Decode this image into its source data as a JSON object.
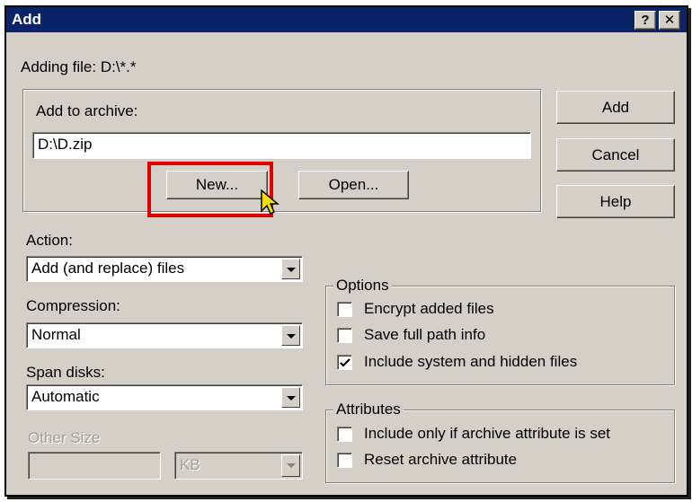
{
  "window": {
    "title": "Add",
    "help_button": "?",
    "close_button": "✕"
  },
  "adding_file_label": "Adding file: D:\\*.*",
  "archive_group": {
    "label": "Add to archive:",
    "path_value": "D:\\D.zip",
    "new_button": "New...",
    "open_button": "Open..."
  },
  "side_buttons": {
    "add": "Add",
    "cancel": "Cancel",
    "help": "Help"
  },
  "action": {
    "label": "Action:",
    "value": "Add (and replace) files"
  },
  "compression": {
    "label": "Compression:",
    "value": "Normal"
  },
  "span_disks": {
    "label": "Span disks:",
    "value": "Automatic"
  },
  "other_size": {
    "label": "Other Size",
    "value": "",
    "unit": "KB"
  },
  "options": {
    "title": "Options",
    "items": [
      {
        "label": "Encrypt added files",
        "checked": false
      },
      {
        "label": "Save full path info",
        "checked": false
      },
      {
        "label": "Include system and hidden files",
        "checked": true
      }
    ]
  },
  "attributes": {
    "title": "Attributes",
    "items": [
      {
        "label": "Include only if archive attribute is set",
        "checked": false
      },
      {
        "label": "Reset archive attribute",
        "checked": false
      }
    ]
  },
  "highlight_color": "#e00000"
}
